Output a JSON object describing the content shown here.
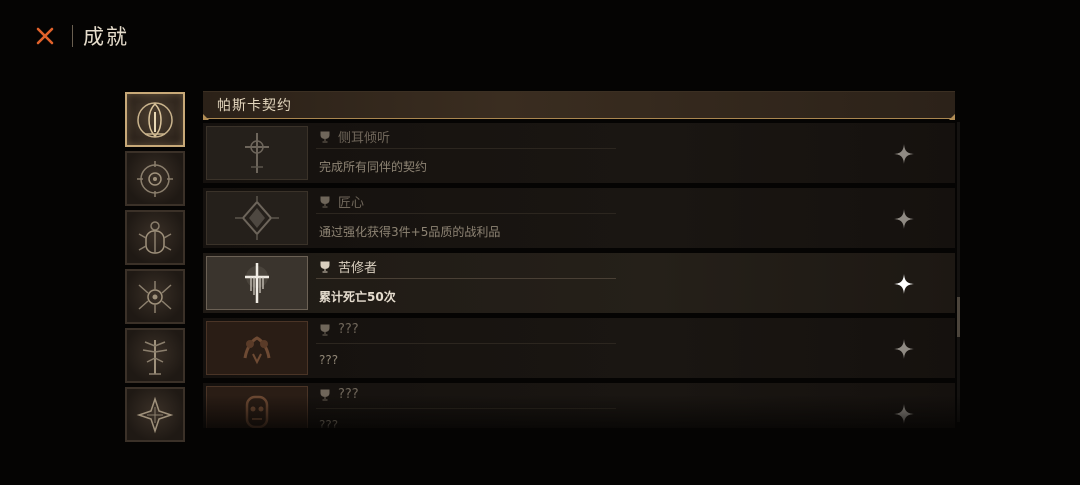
{
  "header": {
    "title": "成就"
  },
  "panel": {
    "category_title": "帕斯卡契约"
  },
  "colors": {
    "accent": "#c8a978",
    "close": "#e2622b",
    "locked_text": "#6f665a"
  },
  "categories": [
    {
      "icon": "hooded-figure-icon",
      "active": true
    },
    {
      "icon": "eye-sigil-icon",
      "active": false
    },
    {
      "icon": "beetle-sigil-icon",
      "active": false
    },
    {
      "icon": "spider-sigil-icon",
      "active": false
    },
    {
      "icon": "tree-sigil-icon",
      "active": false
    },
    {
      "icon": "cracked-sigil-icon",
      "active": false
    }
  ],
  "achievements": [
    {
      "name": "侧耳倾听",
      "desc": "完成所有同伴的契约",
      "state": "locked",
      "icon": "cross-sigil-icon"
    },
    {
      "name": "匠心",
      "desc": "通过强化获得3件+5品质的战利品",
      "state": "locked",
      "icon": "radiant-diamond-icon"
    },
    {
      "name": "苦修者",
      "desc": "累计死亡50次",
      "state": "unlocked",
      "icon": "dripping-cross-icon"
    },
    {
      "name": "???",
      "desc": "???",
      "state": "hidden",
      "icon": "claw-sigil-icon"
    },
    {
      "name": "???",
      "desc": "???",
      "state": "hidden",
      "icon": "mask-sigil-icon"
    }
  ]
}
